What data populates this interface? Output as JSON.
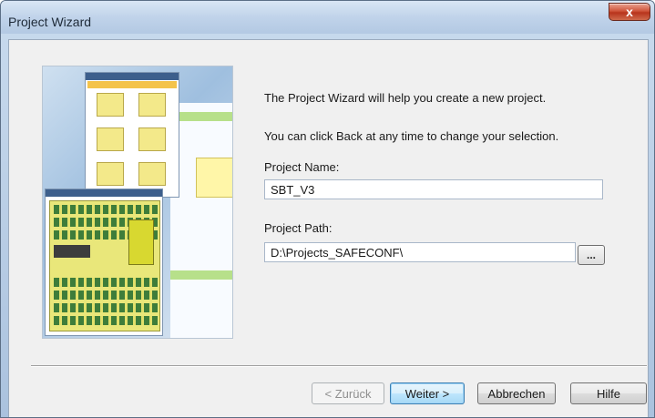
{
  "window": {
    "title": "Project Wizard",
    "close_glyph": "x"
  },
  "intro": {
    "line1": "The Project Wizard will help you create a new project.",
    "line2": "You can click Back at any time to change your selection."
  },
  "project_name": {
    "label": "Project Name:",
    "value": "SBT_V3"
  },
  "project_path": {
    "label": "Project Path:",
    "value": "D:\\Projects_SAFECONF\\",
    "browse_label": "..."
  },
  "buttons": {
    "back": "< Zurück",
    "next": "Weiter >",
    "cancel": "Abbrechen",
    "help": "Hilfe"
  },
  "illustration": {
    "icon": "safeconf-software-screenshot-icon"
  }
}
